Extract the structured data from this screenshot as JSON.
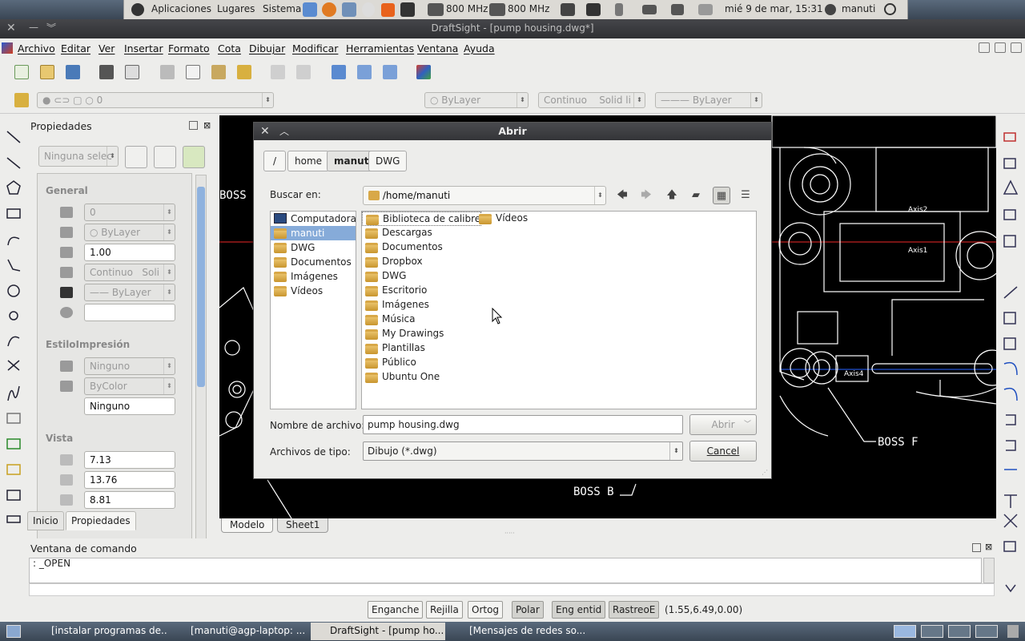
{
  "top_panel": {
    "menus": [
      "Aplicaciones",
      "Lugares",
      "Sistema"
    ],
    "cpu1": "800 MHz",
    "cpu2": "800 MHz",
    "clock": "mié 9 de mar, 15:31",
    "user": "manuti"
  },
  "window": {
    "title": "DraftSight - [pump housing.dwg*]"
  },
  "menubar": [
    "Archivo",
    "Editar",
    "Ver",
    "Insertar",
    "Formato",
    "Cota",
    "Dibujar",
    "Modificar",
    "Herramientas",
    "Ventana",
    "Ayuda"
  ],
  "layer_toolbar": {
    "layer_value": "0",
    "color_value": "ByLayer",
    "linetype_value": "Continuo",
    "linetype_desc": "Solid li",
    "lineweight_value": "ByLayer"
  },
  "properties": {
    "title": "Propiedades",
    "selection": "Ninguna selec",
    "general_header": "General",
    "layer": "0",
    "color": "ByLayer",
    "scale": "1.00",
    "linetype": "Continuo",
    "linetype_desc": "Soli",
    "lineweight": "ByLayer",
    "print_header": "EstiloImpresión",
    "print_style": "Ninguno",
    "print_color": "ByColor",
    "print_value": "Ninguno",
    "view_header": "Vista",
    "view_h": "7.13",
    "view_w": "13.76",
    "view_z": "8.81",
    "tabs": [
      "Inicio",
      "Propiedades"
    ]
  },
  "canvas_labels": {
    "boss_e": "BOSS E",
    "axis2": "Axis2",
    "axis1": "Axis1",
    "axis4": "Axis4",
    "boss_f": "BOSS F",
    "boss_b": "BOSS B"
  },
  "model_tabs": [
    "Modelo",
    "Sheet1"
  ],
  "command": {
    "title": "Ventana de comando",
    "text": ": _OPEN"
  },
  "statusbar": {
    "buttons": [
      "Enganche",
      "Rejilla",
      "Ortog",
      "Polar",
      "Eng entid",
      "RastreoE"
    ],
    "coords": "(1.55,6.49,0.00)"
  },
  "taskbar": {
    "tasks": [
      "[instalar programas de...",
      "[manuti@agp-laptop: ...",
      "DraftSight - [pump ho...",
      "[Mensajes de redes so..."
    ]
  },
  "dialog": {
    "title": "Abrir",
    "breadcrumbs": [
      "/",
      "home",
      "manuti",
      "DWG"
    ],
    "search_label": "Buscar en:",
    "search_path": "/home/manuti",
    "places": [
      "Computadora",
      "manuti",
      "DWG",
      "Documentos",
      "Imágenes",
      "Vídeos"
    ],
    "files_col1": [
      "Biblioteca de calibre",
      "Descargas",
      "Documentos",
      "Dropbox",
      "DWG",
      "Escritorio",
      "Imágenes",
      "Música",
      "My Drawings",
      "Plantillas",
      "Público",
      "Ubuntu One"
    ],
    "files_col2": [
      "Vídeos"
    ],
    "filename_label": "Nombre de archivo:",
    "filename_value": "pump housing.dwg",
    "filetype_label": "Archivos de tipo:",
    "filetype_value": "Dibujo (*.dwg)",
    "open_label": "Abrir",
    "cancel_label": "Cancel"
  }
}
